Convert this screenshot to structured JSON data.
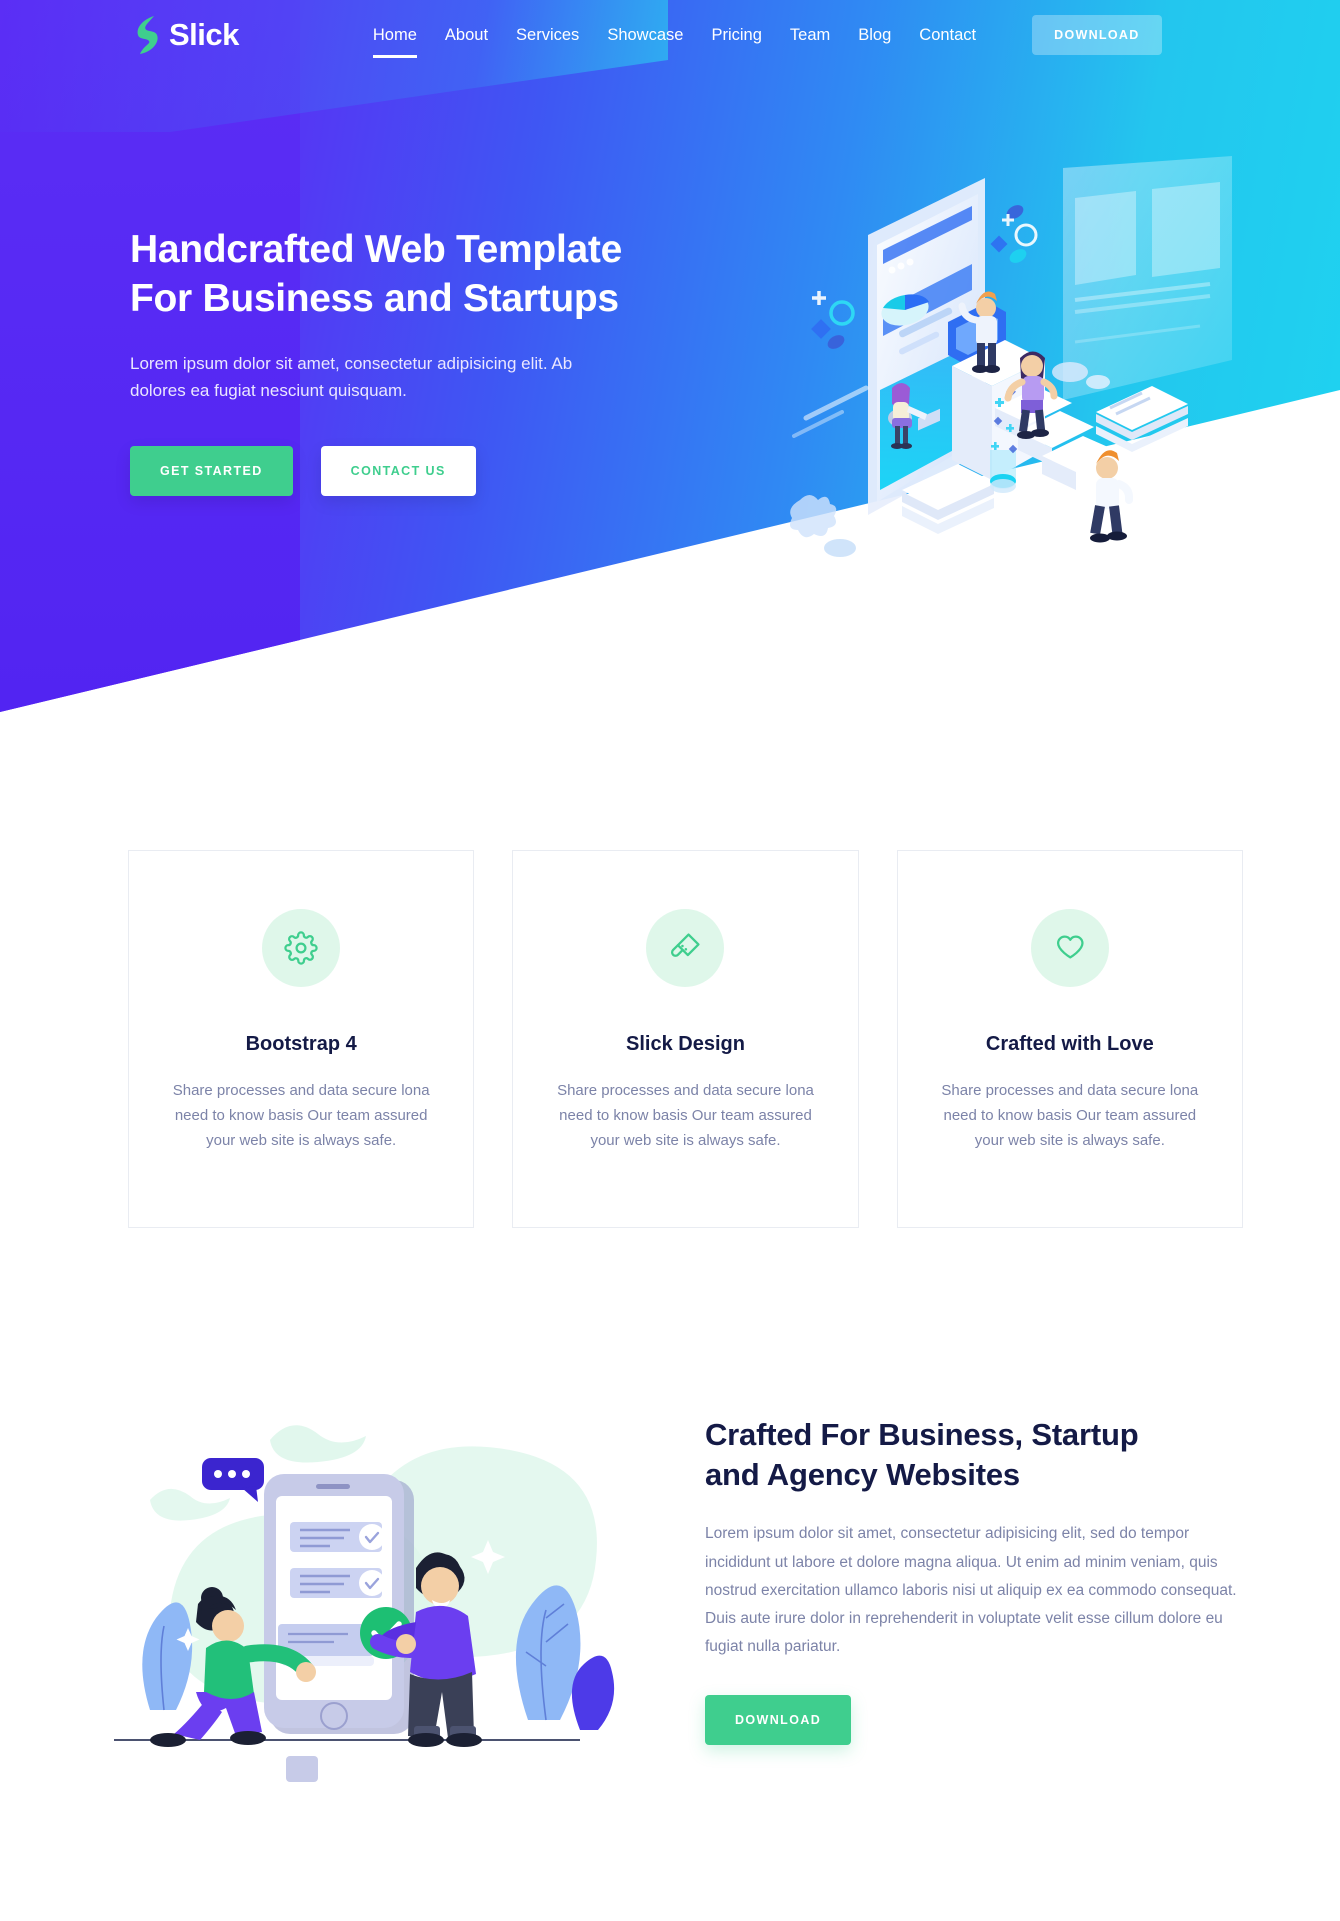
{
  "brand": {
    "name": "Slick",
    "logo_icon": "slick-bolt-logo"
  },
  "nav": {
    "items": [
      {
        "label": "Home",
        "active": true
      },
      {
        "label": "About",
        "active": false
      },
      {
        "label": "Services",
        "active": false
      },
      {
        "label": "Showcase",
        "active": false
      },
      {
        "label": "Pricing",
        "active": false
      },
      {
        "label": "Team",
        "active": false
      },
      {
        "label": "Blog",
        "active": false
      },
      {
        "label": "Contact",
        "active": false
      }
    ],
    "download_label": "DOWNLOAD"
  },
  "hero": {
    "heading_line1": "Handcrafted Web Template",
    "heading_line2": "For Business and Startups",
    "paragraph": "Lorem ipsum dolor sit amet, consectetur adipisicing elit. Ab dolores ea fugiat nesciunt quisquam.",
    "primary_button": "GET STARTED",
    "secondary_button": "CONTACT US",
    "illustration": "isometric-team-devices-illustration"
  },
  "features": [
    {
      "icon": "gear-icon",
      "title": "Bootstrap 4",
      "text": "Share processes and data secure lona need to know basis Our team assured your web site is always safe."
    },
    {
      "icon": "paint-brush-icon",
      "title": "Slick Design",
      "text": "Share processes and data secure lona need to know basis Our team assured your web site is always safe."
    },
    {
      "icon": "heart-icon",
      "title": "Crafted with Love",
      "text": "Share processes and data secure lona need to know basis Our team assured your web site is always safe."
    }
  ],
  "crafted": {
    "heading_line1": "Crafted For Business, Startup",
    "heading_line2": "and Agency Websites",
    "paragraph": "Lorem ipsum dolor sit amet, consectetur adipisicing elit, sed do tempor incididunt ut labore et dolore magna aliqua. Ut enim ad minim veniam, quis nostrud exercitation ullamco laboris nisi ut aliquip ex ea commodo consequat. Duis aute irure dolor in reprehenderit in voluptate velit esse cillum dolore eu fugiat nulla pariatur.",
    "button": "DOWNLOAD",
    "illustration": "people-mobile-checklist-illustration"
  },
  "colors": {
    "brand_purple": "#5b2ef5",
    "brand_cyan": "#1ed4f0",
    "accent_green": "#3fce8e",
    "icon_circle_mint": "#dff7ea",
    "heading_navy": "#141a46",
    "body_gray": "#7c83a8"
  }
}
